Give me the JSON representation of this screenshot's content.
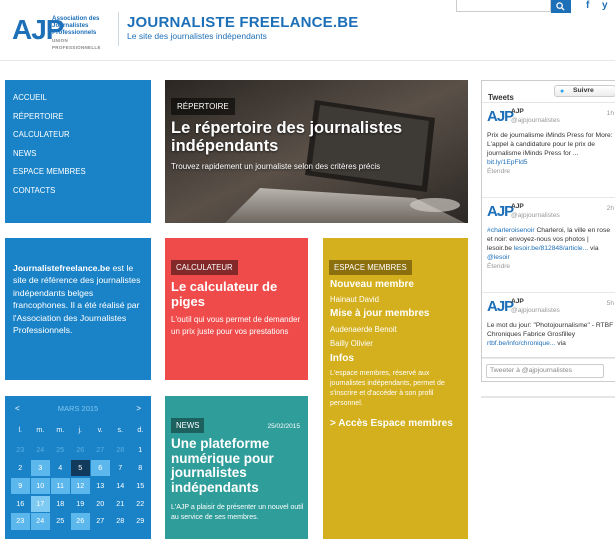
{
  "header": {
    "logo": "AJP",
    "logo_lines": "Association des Journalistes Professionnels",
    "logo_small": "UNION PROFESSIONNELLE",
    "site_title": "JOURNALISTE FREELANCE.BE",
    "site_tagline": "Le site des journalistes indépendants",
    "search_placeholder": "",
    "social": [
      "f",
      "y"
    ],
    "colors": {
      "brand": "#1d6fb8"
    }
  },
  "nav": {
    "items": [
      {
        "label": "ACCUEIL"
      },
      {
        "label": "RÉPERTOIRE"
      },
      {
        "label": "CALCULATEUR"
      },
      {
        "label": "NEWS"
      },
      {
        "label": "ESPACE MEMBRES"
      },
      {
        "label": "CONTACTS"
      }
    ]
  },
  "hero": {
    "tag": "RÉPERTOIRE",
    "title": "Le répertoire des journalistes indépendants",
    "subtitle": "Trouvez rapidement un journaliste selon des critères précis"
  },
  "about": {
    "brand": "Journalistefreelance.be",
    "text": " est le site de référence des journalistes indépendants belges francophones. Il a été réalisé par l'Association des Journalistes Professionnels."
  },
  "calculateur": {
    "tag": "CALCULATEUR",
    "title": "Le calculateur de piges",
    "text": "L'outil qui vous permet de demander un prix juste pour vos prestations",
    "color": "#ef4b4b"
  },
  "members": {
    "tag": "ESPACE MEMBRES",
    "h1": "Nouveau membre",
    "s1": "Hainaut David",
    "h2": "Mise à jour membres",
    "s2": "Audenaerde Benoit",
    "s3": "Bailly Olivier",
    "h3": "Infos",
    "text": "L'espace membres, réservé aux journalistes indépendants, permet de s'inscrire et d'accéder à son profil personnel.",
    "link": "> Accès Espace membres",
    "color": "#d4b01e"
  },
  "twitter": {
    "title": "Tweets",
    "follow": "Suivre",
    "tweets": [
      {
        "name": "AJP",
        "handle": "@ajpjournalistes",
        "time": "1h",
        "text": "Prix de journalisme iMinds Press for More: L'appel à candidature pour le prix de journalisme iMinds Press for ...",
        "link": "bit.ly/1EpFld5",
        "expand": "Étendre"
      },
      {
        "name": "AJP",
        "handle": "@ajpjournalistes",
        "time": "2h",
        "hashtag": "#charleroisenoir",
        "text": " Charleroi, la ville en rose et noir: envoyez-nous vos photos | lesoir.be",
        "link": "lesoir.be/812848/article...",
        "via": " via",
        "mention": "@lesoir",
        "expand": "Étendre"
      },
      {
        "name": "AJP",
        "handle": "@ajpjournalistes",
        "time": "5h",
        "text": "Le mot du jour: \"Photojournalisme\" - RTBF Chroniques Fabrice Grosfilley",
        "link": "rtbf.be/info/chronique...",
        "via": " via"
      }
    ],
    "compose_placeholder": "Tweeter à @ajpjournalistes"
  },
  "calendar": {
    "month": "MARS 2015",
    "prev": "<",
    "next": ">",
    "dow": [
      "l.",
      "m.",
      "m.",
      "j.",
      "v.",
      "s.",
      "d."
    ],
    "weeks": [
      [
        "23",
        "24",
        "25",
        "26",
        "27",
        "28",
        "1"
      ],
      [
        "2",
        "3",
        "4",
        "5",
        "6",
        "7",
        "8"
      ],
      [
        "9",
        "10",
        "11",
        "12",
        "13",
        "14",
        "15"
      ],
      [
        "16",
        "17",
        "18",
        "19",
        "20",
        "21",
        "22"
      ],
      [
        "23",
        "24",
        "25",
        "26",
        "27",
        "28",
        "29"
      ]
    ]
  },
  "news": {
    "tag": "NEWS",
    "date": "25/02/2015",
    "title": "Une plateforme numérique pour journalistes indépendants",
    "text": "L'AJP a plaisir de présenter un nouvel outil au service de ses membres.",
    "color": "#2f9d9a"
  }
}
